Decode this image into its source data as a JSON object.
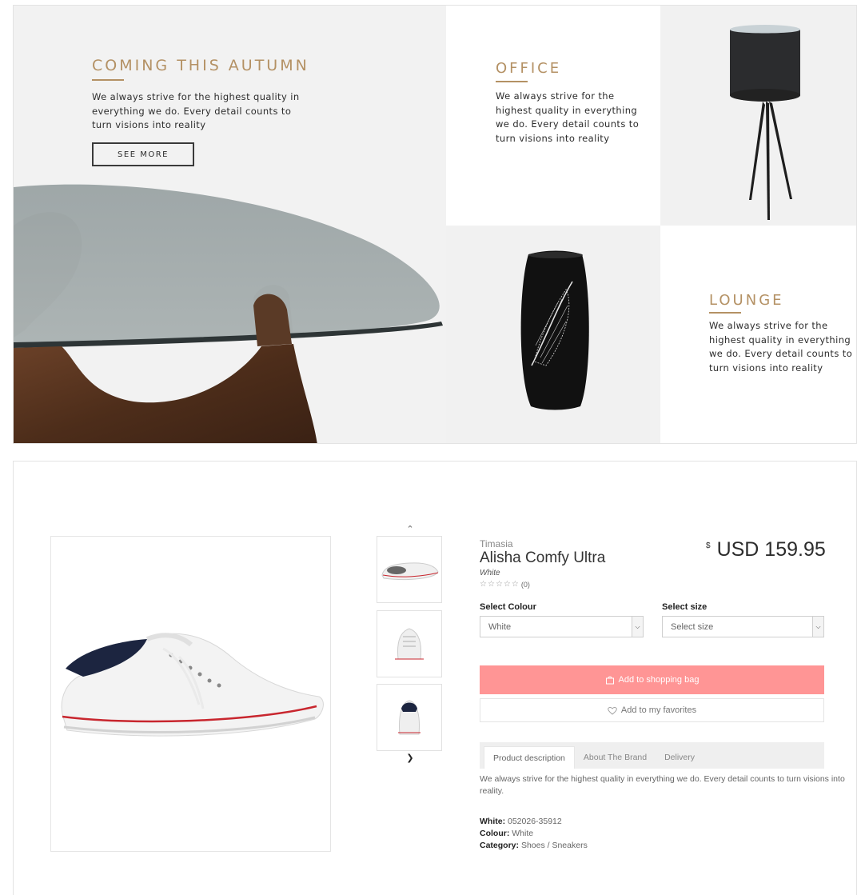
{
  "banner": {
    "autumn": {
      "heading": "COMING THIS AUTUMN",
      "text": "We always strive for the highest quality in everything we do. Every detail counts to turn visions into reality",
      "button": "SEE MORE"
    },
    "office": {
      "heading": "OFFICE",
      "text": "We always strive for the highest quality in everything we do. Every detail counts to turn visions into reality"
    },
    "lounge": {
      "heading": "LOUNGE",
      "text": "We always strive for the highest quality in everything we do. Every detail counts to turn visions into reality"
    },
    "accent_color": "#b49164"
  },
  "product": {
    "brand": "Timasia",
    "title": "Alisha Comfy Ultra",
    "variant": "White",
    "rating_count": "(0)",
    "stars": [
      "☆",
      "☆",
      "☆",
      "☆",
      "☆"
    ],
    "price_currency": "$",
    "price": "USD 159.95",
    "select_colour_label": "Select Colour",
    "select_colour_value": "White",
    "select_size_label": "Select size",
    "select_size_value": "Select size",
    "add_to_bag": "Add to shopping bag",
    "add_to_favorites": "Add to my favorites",
    "tabs": [
      {
        "label": "Product description",
        "active": true
      },
      {
        "label": "About The Brand",
        "active": false
      },
      {
        "label": "Delivery",
        "active": false
      }
    ],
    "description": "We always strive for the highest quality in everything we do. Every detail counts to turn visions into reality.",
    "meta": [
      {
        "label": "White:",
        "value": "052026-35912"
      },
      {
        "label": "Colour:",
        "value": "White"
      },
      {
        "label": "Category:",
        "value": "Shoes / Sneakers"
      }
    ],
    "thumb_up_icon": "chevron-up-icon",
    "thumb_down_icon": "chevron-down-icon",
    "bag_color": "#ff9595"
  }
}
